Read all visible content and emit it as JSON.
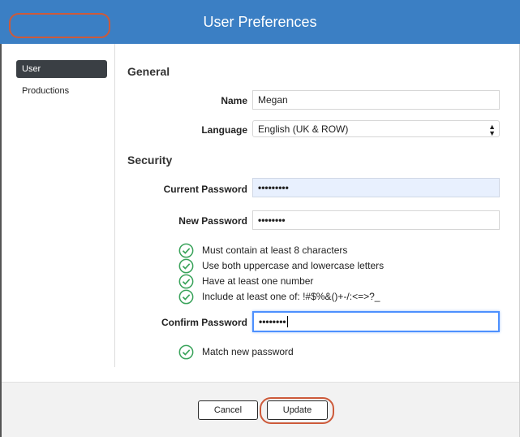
{
  "window": {
    "title": "User Preferences"
  },
  "sidebar": {
    "items": [
      {
        "label": "User"
      },
      {
        "label": "Productions"
      }
    ]
  },
  "general": {
    "title": "General",
    "name_label": "Name",
    "name_value": "Megan",
    "language_label": "Language",
    "language_value": "English (UK & ROW)"
  },
  "security": {
    "title": "Security",
    "current_password_label": "Current Password",
    "current_password_value": "•••••••••",
    "new_password_label": "New Password",
    "new_password_value": "••••••••",
    "rules": [
      {
        "text": "Must contain at least 8 characters"
      },
      {
        "text": "Use both uppercase and lowercase letters"
      },
      {
        "text": "Have at least one number"
      },
      {
        "text": "Include at least one of: !#$%&()+-/:<=>?_"
      }
    ],
    "confirm_password_label": "Confirm Password",
    "confirm_password_value": "••••••••",
    "match_rule": "Match new password"
  },
  "footer": {
    "cancel_label": "Cancel",
    "update_label": "Update"
  },
  "colors": {
    "titlebar": "#3b7fc4",
    "check": "#3aa35b",
    "highlight_ring": "#cd5a3a",
    "focus": "#4d90fe"
  }
}
